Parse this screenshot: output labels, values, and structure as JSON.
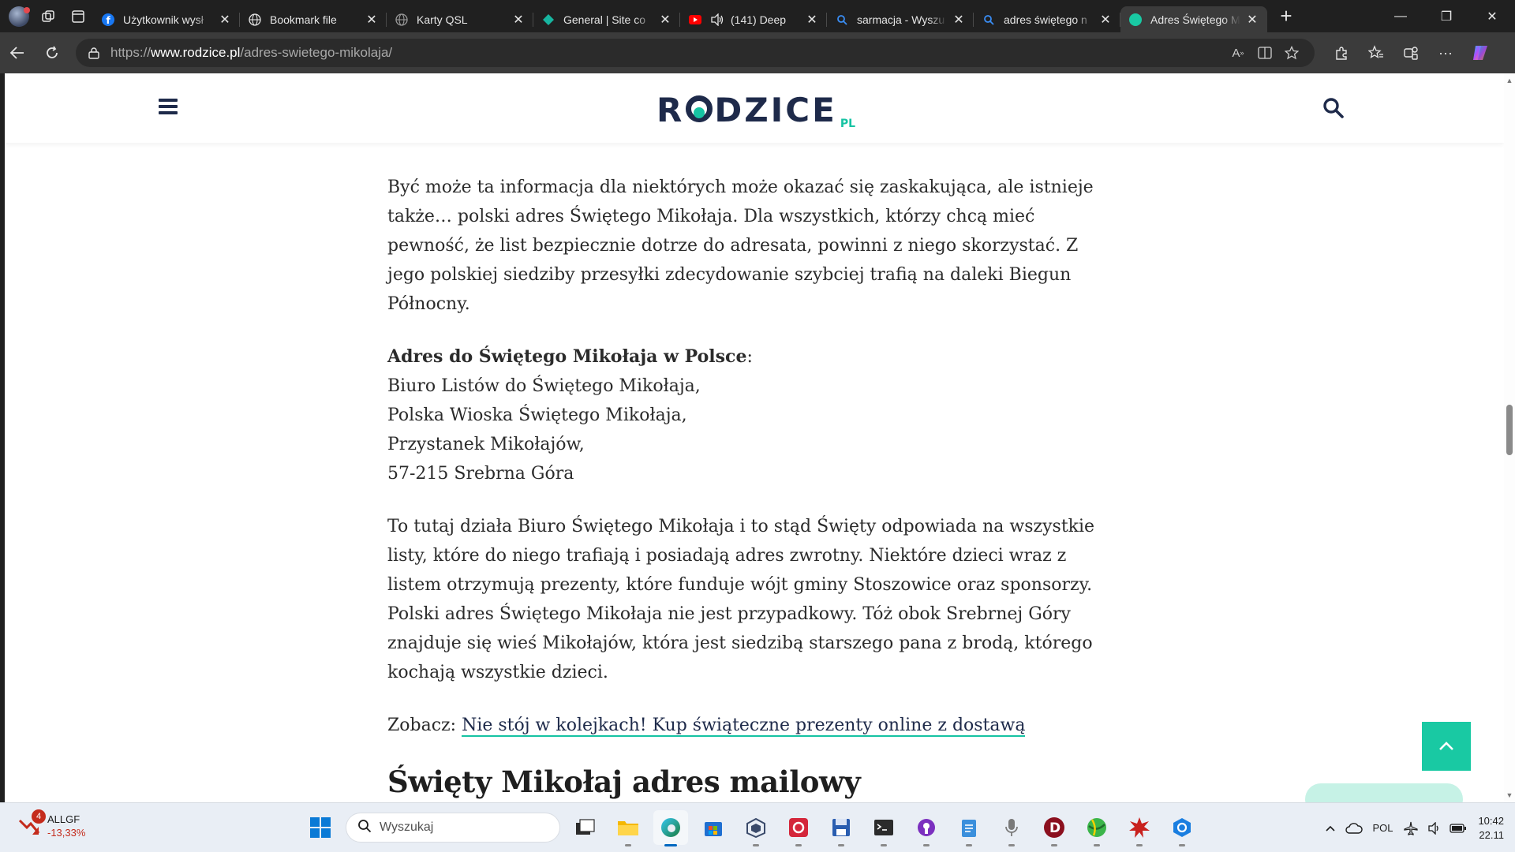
{
  "browser": {
    "tabs": [
      {
        "title": "Użytkownik wysł",
        "favicon": "facebook-icon",
        "active": false
      },
      {
        "title": "Bookmark file",
        "favicon": "globe-icon",
        "active": false
      },
      {
        "title": "Karty QSL",
        "favicon": "globe-icon",
        "active": false
      },
      {
        "title": "General | Site co",
        "favicon": "teal-diamond-icon",
        "active": false
      },
      {
        "title": "(141) Deep",
        "favicon": "youtube-icon",
        "active": false
      },
      {
        "title": "sarmacja - Wyszu",
        "favicon": "search-icon",
        "active": false
      },
      {
        "title": "adres świętego n",
        "favicon": "search-icon",
        "active": false
      },
      {
        "title": "Adres Świętego M",
        "favicon": "rodzice-icon",
        "active": true
      }
    ],
    "url": {
      "scheme": "https://",
      "host": "www.rodzice.pl",
      "path": "/adres-swietego-mikolaja/"
    }
  },
  "site": {
    "logo_text": "R",
    "logo_text_rest": "DZICE",
    "logo_suffix": "PL",
    "brand_color": "#16c3a3",
    "navy_color": "#1e2a4a"
  },
  "article": {
    "intro": "Być może ta informacja dla niektórych może okazać się zaskakująca, ale istnieje także… polski adres Świętego Mikołaja. Dla wszystkich, którzy chcą mieć pewność, że list bezpiecznie dotrze do adresata, powinni z niego skorzystać. Z jego polskiej siedziby przesyłki zdecydowanie szybciej trafią na daleki Biegun Północny.",
    "address_label": "Adres do Świętego Mikołaja w Polsce",
    "address_colon": ":",
    "address_lines": [
      "Biuro Listów do Świętego Mikołaja,",
      "Polska Wioska Świętego Mikołaja,",
      "Przystanek Mikołajów,",
      "57-215 Srebrna Góra"
    ],
    "body": "To tutaj działa Biuro Świętego Mikołaja i to stąd Święty odpowiada na wszystkie listy, które do niego trafiają i posiadają adres zwrotny. Niektóre dzieci wraz z listem otrzymują prezenty, które funduje wójt gminy Stoszowice oraz sponsorzy. Polski adres Świętego Mikołaja nie jest przypadkowy. Tóż obok Srebrnej Góry znajduje się wieś Mikołajów, która jest siedzibą starszego pana z brodą, którego kochają wszystkie dzieci.",
    "see_also_prefix": "Zobacz: ",
    "see_also_link": "Nie stój w kolejkach! Kup świąteczne prezenty online z dostawą",
    "heading": "Święty Mikołaj adres mailowy"
  },
  "taskbar": {
    "stock_badge": "4",
    "stock_name": "ALLGF",
    "stock_change": "-13,33%",
    "search_placeholder": "Wyszukaj",
    "apps": [
      "task-view-icon",
      "file-explorer-icon",
      "edge-icon",
      "store-icon",
      "vmware-icon",
      "app-red-icon",
      "save-icon",
      "terminal-icon",
      "purple-app-icon",
      "notepad-icon",
      "microphone-icon",
      "d-app-icon",
      "green-ball-icon",
      "red-splat-icon",
      "blue-app-icon"
    ],
    "language": "POL",
    "time": "10:42",
    "date": "22.11"
  }
}
